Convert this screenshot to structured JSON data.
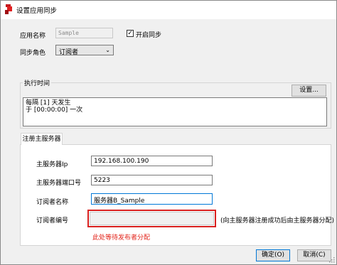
{
  "window": {
    "title": "设置应用同步",
    "icon": "app-red-icon",
    "colors": {
      "accent_red": "#d9201f",
      "hint_red": "#e2231a",
      "textbox_focus": "#0078d7"
    }
  },
  "app_name": {
    "label": "应用名称",
    "value": "Sample"
  },
  "enable_sync": {
    "label": "开启同步",
    "checked": true
  },
  "sync_role": {
    "label": "同步角色",
    "selected": "订阅者"
  },
  "schedule": {
    "group_title": "执行时间",
    "settings_button": "设置...",
    "lines": [
      "每隔 [1] 天发生",
      "于 [00:00:00] 一次"
    ]
  },
  "register": {
    "tab_label": "注册主服务器",
    "server_ip": {
      "label": "主服务器Ip",
      "value": "192.168.100.190"
    },
    "server_port": {
      "label": "主服务器端口号",
      "value": "5223"
    },
    "subscriber_name": {
      "label": "订阅者名称",
      "value": "服务器B_Sample"
    },
    "subscriber_id": {
      "label": "订阅者编号",
      "value": "",
      "note": "(向主服务器注册成功后由主服务器分配)",
      "warning": "此处等待发布者分配"
    }
  },
  "buttons": {
    "ok": "确定(O)",
    "cancel": "取消(C)"
  }
}
